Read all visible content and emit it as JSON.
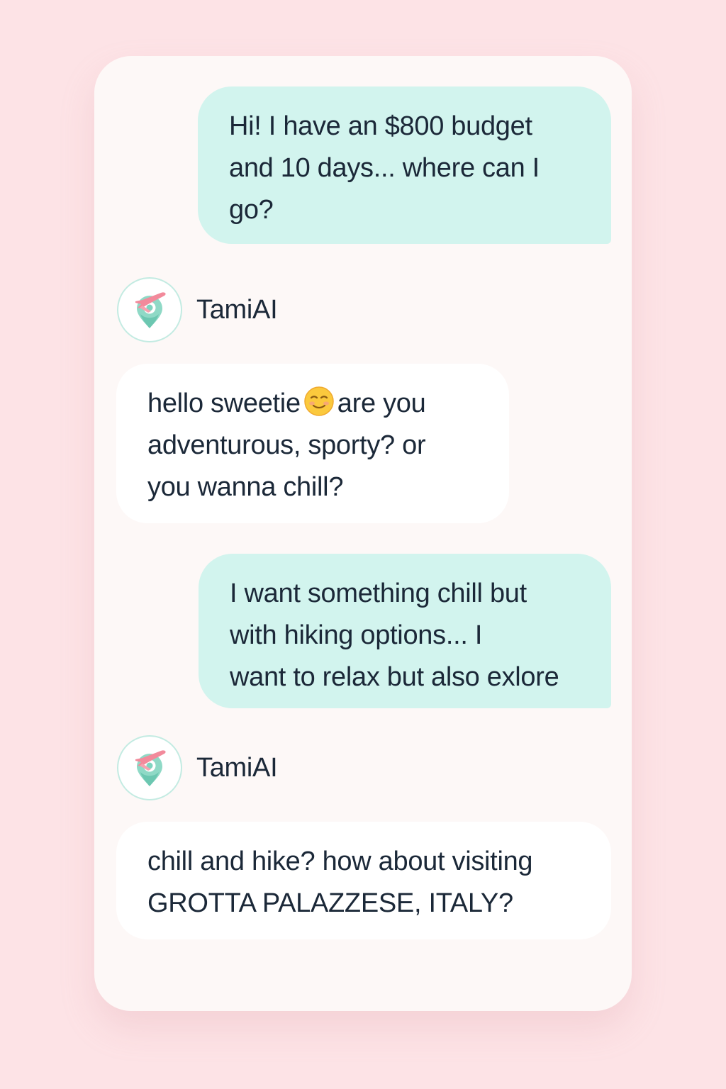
{
  "assistant": {
    "name": "TamiAI",
    "avatar_icon": "plane-location-pin-icon"
  },
  "colors": {
    "page_background": "#fde3e6",
    "card_background": "#fdf8f7",
    "user_bubble": "#d2f4ee",
    "assistant_bubble": "#ffffff",
    "text": "#1b2838",
    "plane_accent": "#f28a9b",
    "pin_accent": "#7fd3bf"
  },
  "messages": [
    {
      "role": "user",
      "lines": [
        "Hi! I have an $800 budget",
        "and 10 days... where can I",
        "go?"
      ]
    },
    {
      "role": "assistant",
      "sender": "TamiAI",
      "lines": [
        "hello sweetie",
        "are you",
        "adventurous, sporty? or",
        "you wanna chill?"
      ],
      "emoji": "smiling-face-emoji"
    },
    {
      "role": "user",
      "lines": [
        "I want something chill but",
        "with hiking options... I",
        "want to relax but also exlore"
      ]
    },
    {
      "role": "assistant",
      "sender": "TamiAI",
      "lines": [
        "chill and hike? how about visiting",
        "GROTTA PALAZZESE, ITALY?"
      ]
    }
  ]
}
